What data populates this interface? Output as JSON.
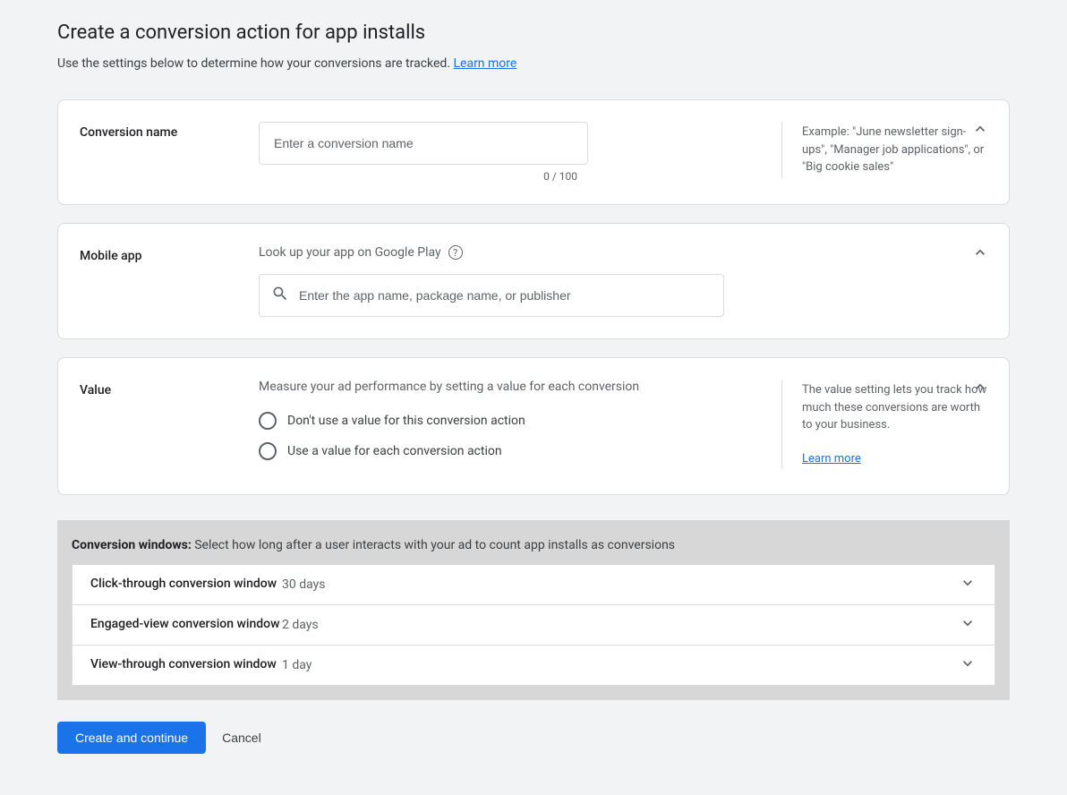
{
  "header": {
    "title": "Create a conversion action for app installs",
    "subtitle_prefix": "Use the settings below to determine how your conversions are tracked. ",
    "learn_more": "Learn more"
  },
  "conversion_name": {
    "label": "Conversion name",
    "placeholder": "Enter a conversion name",
    "char_count": "0 / 100",
    "example": "Example: \"June newsletter sign-ups\", \"Manager job applications\", or \"Big cookie sales\""
  },
  "mobile_app": {
    "label": "Mobile app",
    "helper": "Look up your app on Google Play",
    "placeholder": "Enter the app name, package name, or publisher"
  },
  "value": {
    "label": "Value",
    "helper": "Measure your ad performance by setting a value for each conversion",
    "option_no_value": "Don't use a value for this conversion action",
    "option_use_value": "Use a value for each conversion action",
    "side_text": "The value setting lets you track how much these conversions are worth to your business.",
    "learn_more": "Learn more"
  },
  "windows": {
    "title": "Conversion windows:",
    "subtitle": " Select how long after a user interacts with your ad to count app installs as conversions",
    "rows": [
      {
        "label": "Click-through conversion window",
        "value": "30 days"
      },
      {
        "label": "Engaged-view conversion window",
        "value": "2 days"
      },
      {
        "label": "View-through conversion window",
        "value": "1 day"
      }
    ]
  },
  "footer": {
    "primary": "Create and continue",
    "cancel": "Cancel"
  }
}
